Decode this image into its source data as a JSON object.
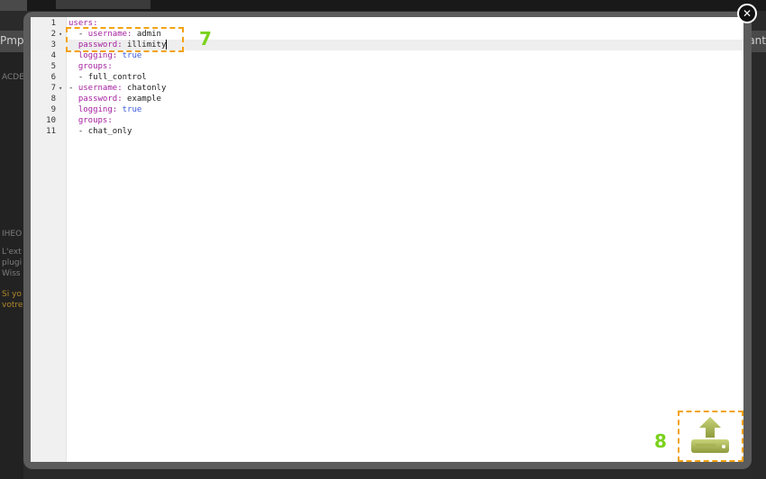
{
  "background": {
    "nav_left_text": "Pmp",
    "nav_right_text": "tant",
    "side_texts": [
      "ACDE",
      "IHEO",
      "L'ext",
      "plugi",
      "Wiss"
    ],
    "side_orange_texts": [
      "Si yo",
      "votre"
    ]
  },
  "editor": {
    "lines": [
      {
        "num": "1",
        "fold": "",
        "indent": "",
        "key": "users:",
        "value": "",
        "value_kind": ""
      },
      {
        "num": "2",
        "fold": "▾",
        "indent": "  - ",
        "key": "username:",
        "value": " admin",
        "value_kind": "val"
      },
      {
        "num": "3",
        "fold": "",
        "indent": "  ",
        "key": "password:",
        "value": " illimity",
        "value_kind": "val"
      },
      {
        "num": "4",
        "fold": "",
        "indent": "  ",
        "key": "logging:",
        "value": " true",
        "value_kind": "kw"
      },
      {
        "num": "5",
        "fold": "",
        "indent": "  ",
        "key": "groups:",
        "value": "",
        "value_kind": ""
      },
      {
        "num": "6",
        "fold": "",
        "indent": "  - ",
        "key": "",
        "value": "full_control",
        "value_kind": "val"
      },
      {
        "num": "7",
        "fold": "▾",
        "indent": "- ",
        "key": "username:",
        "value": " chatonly",
        "value_kind": "val"
      },
      {
        "num": "8",
        "fold": "",
        "indent": "  ",
        "key": "password:",
        "value": " example",
        "value_kind": "val"
      },
      {
        "num": "9",
        "fold": "",
        "indent": "  ",
        "key": "logging:",
        "value": " true",
        "value_kind": "kw"
      },
      {
        "num": "10",
        "fold": "",
        "indent": "  ",
        "key": "groups:",
        "value": "",
        "value_kind": ""
      },
      {
        "num": "11",
        "fold": "",
        "indent": "  - ",
        "key": "",
        "value": "chat_only",
        "value_kind": "val"
      }
    ],
    "active_line": 3
  },
  "annotations": {
    "step7": "7",
    "step8": "8"
  },
  "icons": {
    "close": "close-icon",
    "upload": "upload-icon"
  },
  "colors": {
    "annotation_border": "#f3a212",
    "annotation_number": "#7ad21c",
    "yaml_key": "#a31e9e",
    "yaml_bool": "#3b5bdb"
  }
}
